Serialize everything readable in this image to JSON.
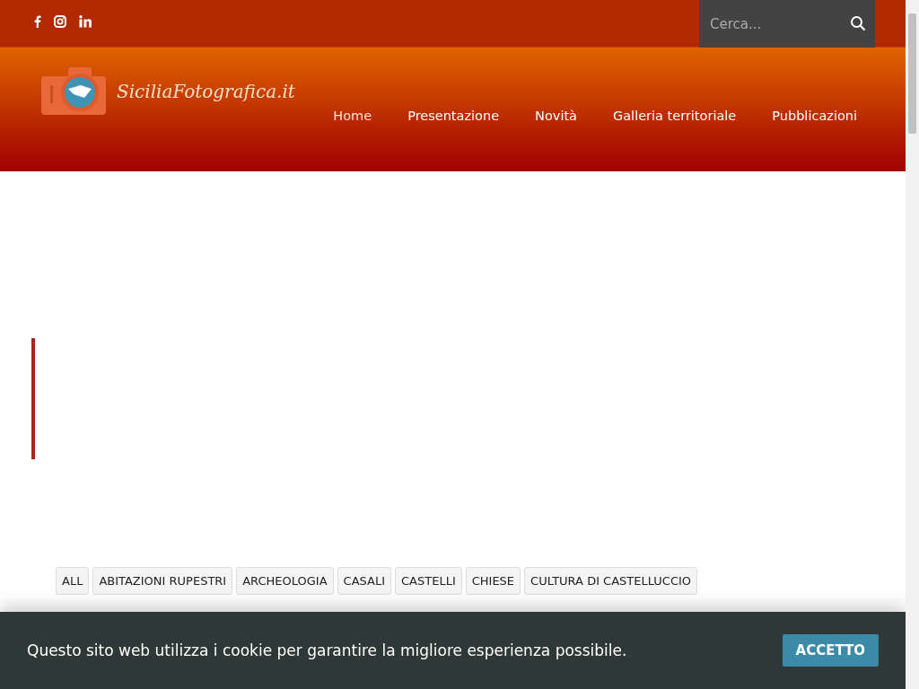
{
  "top_bar": {
    "social": [
      {
        "kind": "facebook"
      },
      {
        "kind": "instagram"
      },
      {
        "kind": "linkedin"
      }
    ],
    "search": {
      "placeholder": "Cerca..."
    }
  },
  "header": {
    "logo_text": "SiciliaFotografica.it",
    "nav": [
      {
        "label": "Home",
        "selected": true
      },
      {
        "label": "Presentazione",
        "selected": false
      },
      {
        "label": "Novità",
        "selected": false
      },
      {
        "label": "Galleria territoriale",
        "selected": false
      },
      {
        "label": "Pubblicazioni",
        "selected": false
      }
    ]
  },
  "filters": [
    {
      "label": "ALL"
    },
    {
      "label": "ABITAZIONI RUPESTRI"
    },
    {
      "label": "ARCHEOLOGIA"
    },
    {
      "label": "CASALI"
    },
    {
      "label": "CASTELLI"
    },
    {
      "label": "CHIESE"
    },
    {
      "label": "CULTURA DI CASTELLUCCIO"
    }
  ],
  "cookie_bar": {
    "message": "Questo sito web utilizza i cookie per garantire la migliore esperienza possibile.",
    "button": "ACCETTO"
  }
}
